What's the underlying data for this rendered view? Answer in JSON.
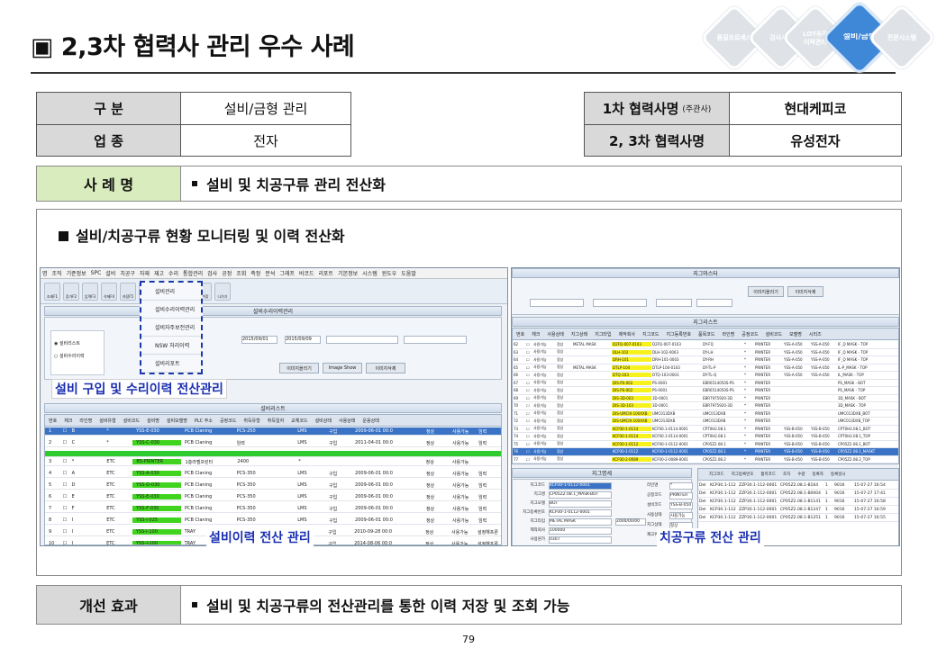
{
  "title": "2,3차 협력사 관리 우수 사례",
  "nav": {
    "items": [
      {
        "label": "품질프로세스"
      },
      {
        "label": "검사시험"
      },
      {
        "label": "LOT추적\n이력관리"
      },
      {
        "label": "설비/금형"
      },
      {
        "label": "전문시스템"
      }
    ]
  },
  "info_table": {
    "rows": [
      {
        "label": "구  분",
        "value": "설비/금형 관리",
        "label2": "1차 협력사명",
        "label2_note": "(주관사)",
        "value2": "현대케피코"
      },
      {
        "label": "업  종",
        "value": "전자",
        "label2": "2, 3차 협력사명",
        "value2": "유성전자"
      }
    ]
  },
  "case": {
    "label": "사 례 명",
    "text": "설비 및 치공구류 관리 전산화"
  },
  "content": {
    "heading": "설비/치공구류 현황 모니터링 및 이력 전산화",
    "captions": {
      "purchase": "설비 구입 및 수리이력 전산관리",
      "equipment_history": "설비이력 전산 관리",
      "jig": "치공구류 전산 관리"
    },
    "left_app": {
      "menubar": [
        "명",
        "조직",
        "기준정보",
        "SPC",
        "설비",
        "치공구",
        "자재",
        "재고",
        "수리",
        "통합관리",
        "검사",
        "공정",
        "조회",
        "측정",
        "분석",
        "그래프",
        "바코드",
        "리포트",
        "기본정보",
        "시스템",
        "윈도우",
        "도움말"
      ],
      "toolbar": [
        "조회F1",
        "증가F2",
        "입력F3",
        "삭제F4",
        "저장F5",
        "전체화",
        "전체축",
        "크기고",
        "즐겨찾",
        "나가기"
      ],
      "dropdown": [
        "설비관리",
        "설비수리이력관리",
        "설비자주보전관리",
        "NSW 처리이력",
        "설비리포트"
      ],
      "upper_window_title": "설비수리이력관리",
      "filters": {
        "date_from": "2015/09/01",
        "date_to": "2015/09/09"
      },
      "upper_buttons": [
        "이미지올리기",
        "Image Show",
        "이미지삭제"
      ],
      "list_title": "설비리스트",
      "grid_headers": [
        "번호",
        "체크",
        "라인명",
        "설비유형",
        "설비코드",
        "설비명",
        "설비모델명",
        "PLC 주소",
        "공정코드",
        "취득유형",
        "취득일자",
        "교체코드",
        "설비상태",
        "사용상태",
        "운용상태"
      ],
      "grid_rows": [
        {
          "no": "1",
          "line": "B",
          "type": "*",
          "code": "YSS-E-030",
          "name": "PCB Claning",
          "model": "PCS-250",
          "proc": "LMS",
          "acq": "구입",
          "date": "2009-06-01 00:0",
          "status": "정상",
          "use": "사용가능",
          "op": "임력"
        },
        {
          "no": "2",
          "line": "C",
          "type": "*",
          "code": "YSS-C-030",
          "name": "PCB Claning",
          "model": "임력",
          "proc": "LMS",
          "acq": "구입",
          "date": "2011-04-01 00:0",
          "status": "정상",
          "use": "사용가능",
          "op": "임력"
        },
        {
          "no": "3",
          "line": "*",
          "type": "ETC",
          "code": "BS-PRINTER",
          "name": "1층라벨프린터",
          "model": "2400",
          "proc": "*",
          "acq": "",
          "date": "",
          "status": "정상",
          "use": "사용가능",
          "op": ""
        },
        {
          "no": "4",
          "line": "A",
          "type": "ETC",
          "code": "YSS-A-030",
          "name": "PCB Claning",
          "model": "PCS-350",
          "proc": "LMS",
          "acq": "구입",
          "date": "2009-06-01 00:0",
          "status": "정상",
          "use": "사용가능",
          "op": "임력"
        },
        {
          "no": "5",
          "line": "D",
          "type": "ETC",
          "code": "YSS-D-030",
          "name": "PCB Claning",
          "model": "PCS-350",
          "proc": "LMS",
          "acq": "구입",
          "date": "2009-06-01 00:0",
          "status": "정상",
          "use": "사용가능",
          "op": "임력"
        },
        {
          "no": "6",
          "line": "E",
          "type": "ETC",
          "code": "YSS-E-030",
          "name": "PCB Claning",
          "model": "PCS-350",
          "proc": "LMS",
          "acq": "구입",
          "date": "2009-06-01 00:0",
          "status": "정상",
          "use": "사용가능",
          "op": "임력"
        },
        {
          "no": "7",
          "line": "F",
          "type": "ETC",
          "code": "YSS-F-030",
          "name": "PCB Claning",
          "model": "PCS-350",
          "proc": "LMS",
          "acq": "구입",
          "date": "2009-06-01 00:0",
          "status": "정상",
          "use": "사용가능",
          "op": "임력"
        },
        {
          "no": "8",
          "line": "I",
          "type": "ETC",
          "code": "YSS-I-025",
          "name": "PCB Claning",
          "model": "PCS-350",
          "proc": "LMS",
          "acq": "구입",
          "date": "2009-06-01 00:0",
          "status": "정상",
          "use": "사용가능",
          "op": "임력"
        },
        {
          "no": "9",
          "line": "I",
          "type": "ETC",
          "code": "YSS-I-100",
          "name": "TRAY",
          "model": "STF-1005",
          "proc": "W10",
          "acq": "구입",
          "date": "2010-09-28 00:0",
          "status": "정상",
          "use": "사용가능",
          "op": "설정해프론"
        },
        {
          "no": "10",
          "line": "J",
          "type": "ETC",
          "code": "YSS-J-100",
          "name": "TRAY",
          "model": "STF-1005",
          "proc": "W10",
          "acq": "구입",
          "date": "2014-08-06 00:0",
          "status": "정상",
          "use": "사용가능",
          "op": "설정해프론"
        }
      ]
    },
    "right_app": {
      "master_title": "지그마스터",
      "master_buttons": [
        "이미지올리기",
        "이미지삭제"
      ],
      "list_title": "지그리스트",
      "grid_headers": [
        "번호",
        "체크",
        "사용상태",
        "지그상태",
        "지그타입",
        "제작회사",
        "지그코드",
        "지그등록번호",
        "품목코드",
        "라인명",
        "공정코드",
        "설비코드",
        "모델명",
        "시리즈"
      ],
      "grid_rows": [
        {
          "no": "62",
          "use": "사용가능",
          "state": "정상",
          "type": "METAL MASK",
          "code": "D2FQ-007-0103",
          "reg": "D2FQ-007-0103",
          "item": "DY-FQ",
          "proc": "PRINTER",
          "eq": "YSS-A-050",
          "eq2": "YSS-A-050",
          "model": "IF_Q MASK - TOP"
        },
        {
          "no": "63",
          "use": "사용가능",
          "state": "정상",
          "type": "",
          "code": "DLH-102",
          "reg": "DLH-102-0003",
          "item": "DY-LH",
          "proc": "PRINTER",
          "eq": "YSS-A-050",
          "eq2": "YSS-A-050",
          "model": "IF_Q MASK - TOP"
        },
        {
          "no": "64",
          "use": "사용가능",
          "state": "정상",
          "type": "",
          "code": "DRH-101",
          "reg": "DRH-101-0003",
          "item": "DY-RH",
          "proc": "PRINTER",
          "eq": "YSS-A-050",
          "eq2": "YSS-A-050",
          "model": "IF_Q MASK - TOP"
        },
        {
          "no": "65",
          "use": "사용가능",
          "state": "정상",
          "type": "METAL MASK",
          "code": "DTLP-104",
          "reg": "DTLP-104-0103",
          "item": "DY-TL-P",
          "proc": "PRINTER",
          "eq": "YSS-A-050",
          "eq2": "YSS-A-050",
          "model": "IL-P_MASK - TOP"
        },
        {
          "no": "66",
          "use": "사용가능",
          "state": "정상",
          "type": "",
          "code": "DTQ-103",
          "reg": "DTQ-103-0003",
          "item": "DY-TL-Q",
          "proc": "PRINTER",
          "eq": "YSS-A-050",
          "eq2": "YSS-A-050",
          "model": "IL_MASK - TOP"
        },
        {
          "no": "67",
          "use": "사용가능",
          "state": "정상",
          "type": "",
          "code": "DIS-PS-002",
          "reg": "PS-0001",
          "item": "EBR6514050S-PS",
          "proc": "PRINTER",
          "eq": "",
          "eq2": "",
          "model": "PS_MASK - BOT"
        },
        {
          "no": "68",
          "use": "사용가능",
          "state": "정상",
          "type": "",
          "code": "DIS-PS-002",
          "reg": "PS-0001",
          "item": "EBR6514050S-PS",
          "proc": "PRINTER",
          "eq": "",
          "eq2": "",
          "model": "PS_MASK - TOP"
        },
        {
          "no": "69",
          "use": "사용가능",
          "state": "정상",
          "type": "",
          "code": "DIS-3D-003",
          "reg": "3D-0001",
          "item": "EBR7975920-3D",
          "proc": "PRINTER",
          "eq": "",
          "eq2": "",
          "model": "3D_MASK - BOT"
        },
        {
          "no": "70",
          "use": "사용가능",
          "state": "정상",
          "type": "",
          "code": "DIS-3D-103",
          "reg": "3D-0001",
          "item": "EBR7975920-3D",
          "proc": "PRINTER",
          "eq": "",
          "eq2": "",
          "model": "3D_MASK - TOP"
        },
        {
          "no": "71",
          "use": "사용가능",
          "state": "정상",
          "type": "",
          "code": "DIS-UMCIX-100XXB",
          "reg": "UMC013DXB",
          "item": "UMC013DXB",
          "proc": "PRINTER",
          "eq": "",
          "eq2": "",
          "model": "UMC013DXB_BOT"
        },
        {
          "no": "72",
          "use": "사용가능",
          "state": "정상",
          "type": "",
          "code": "DIS-UMCIX-100XXB",
          "reg": "UMC013DXB",
          "item": "UMC013DXB",
          "proc": "PRINTER",
          "eq": "",
          "eq2": "",
          "model": "UMC013DXB_TOP"
        },
        {
          "no": "73",
          "use": "사용가능",
          "state": "정상",
          "type": "",
          "code": "KCP30-1-0114",
          "reg": "KCP30.1-0114-0001",
          "item": "CPT0H2.08.1",
          "proc": "PRINTER",
          "eq": "YSS-B-050",
          "eq2": "YSS-B-050",
          "model": "CPT0H2.08.1_BOT"
        },
        {
          "no": "74",
          "use": "사용가능",
          "state": "정상",
          "type": "",
          "code": "KCP30-1-0114",
          "reg": "KCP30.1-0114-0001",
          "item": "CPT0H2.08.1",
          "proc": "PRINTER",
          "eq": "YSS-B-050",
          "eq2": "YSS-B-050",
          "model": "CPT0H2.08.1_TOP"
        },
        {
          "no": "75",
          "use": "사용가능",
          "state": "정상",
          "type": "",
          "code": "KCP30-1-0112",
          "reg": "KCP30-1-0112-0001",
          "item": "CP05Z2.08.1",
          "proc": "PRINTER",
          "eq": "YSS-B-050",
          "eq2": "YSS-B-050",
          "model": "CP05Z2.08.1_BOT"
        },
        {
          "no": "76",
          "use": "사용가능",
          "state": "정상",
          "type": "",
          "code": "KCP30-1-0112",
          "reg": "KCP30-1-0112-0001",
          "item": "CP05Z2.08.1",
          "proc": "PRINTER",
          "eq": "YSS-B-050",
          "eq2": "YSS-B-050",
          "model": "CP05Z2.08.1_MASKT"
        },
        {
          "no": "77",
          "use": "사용가능",
          "state": "정상",
          "type": "",
          "code": "KCP30-2-0089",
          "reg": "KCP30-2-0089-0001",
          "item": "CP05Z2.08.2",
          "proc": "PRINTER",
          "eq": "YSS-B-050",
          "eq2": "YSS-B-050",
          "model": "CP05Z2.08.2_TOP"
        }
      ],
      "detail_title": "지그명세",
      "detail_fields": [
        {
          "label": "지그코드",
          "value": "KCP30-1-0112-0001"
        },
        {
          "label": "지그명",
          "value": "CP05Z2.08.1_MASK-BOT"
        },
        {
          "label": "지그모델",
          "value": "BOT"
        },
        {
          "label": "지그등록번호",
          "value": "KCP30-1-0112-0001"
        },
        {
          "label": "지그타입",
          "value": "METAL MASK"
        },
        {
          "label": "제작회사",
          "value": "100000"
        },
        {
          "label": "사용원가",
          "value": "0307"
        }
      ],
      "detail_date": "2000/00/00",
      "detail_right": [
        {
          "label": "라인명",
          "value": "*"
        },
        {
          "label": "공정코드",
          "value": "PRINTER"
        },
        {
          "label": "설비코드",
          "value": "YSS-B-050"
        },
        {
          "label": "사용상태",
          "value": "사용가능"
        },
        {
          "label": "지그상태",
          "value": "정상"
        },
        {
          "label": "재고위치",
          "value": "금형"
        }
      ],
      "history_headers": [
        "",
        "지그코드",
        "지그등록번호",
        "품목코드",
        "조치",
        "수량",
        "등록자",
        "등록일시"
      ],
      "history_rows": [
        {
          "t": "Del",
          "code": "KCP30.1-112",
          "reg": "ZZP30.1-112-0001",
          "item": "CP05Z2.08.1-B164",
          "act": "1",
          "qty": "9016",
          "date": "15-07-27 16:54"
        },
        {
          "t": "Del",
          "code": "KCP30.1-112",
          "reg": "ZZP30.1-112-0001",
          "item": "CP05Z2.08.1-B0004",
          "act": "1",
          "qty": "9016",
          "date": "15-07-27 17:41"
        },
        {
          "t": "Del",
          "code": "KCP30.1-112",
          "reg": "ZZP30.1-112-0001",
          "item": "CP05Z2.08.1-B1141",
          "act": "1",
          "qty": "9016",
          "date": "15-07-27 16:58"
        },
        {
          "t": "Del",
          "code": "KCP30.1-112",
          "reg": "ZZP30.1-112-0001",
          "item": "CP05Z2.08.1-B1247",
          "act": "1",
          "qty": "9016",
          "date": "15-07-27 16:59"
        },
        {
          "t": "Del",
          "code": "KCP30.1-112",
          "reg": "ZZP30.1-112-0001",
          "item": "CP05Z2.08.1-B1251",
          "act": "1",
          "qty": "9016",
          "date": "15-07-27 16:55"
        }
      ]
    }
  },
  "effect": {
    "label": "개선 효과",
    "text": "설비 및 치공구류의 전산관리를 통한 이력 저장 및 조회 가능"
  },
  "page_number": "79",
  "colors": {
    "accent_blue": "#3f88d8",
    "green_label": "#d8ecbd",
    "caption_blue": "#1a2fb2"
  }
}
